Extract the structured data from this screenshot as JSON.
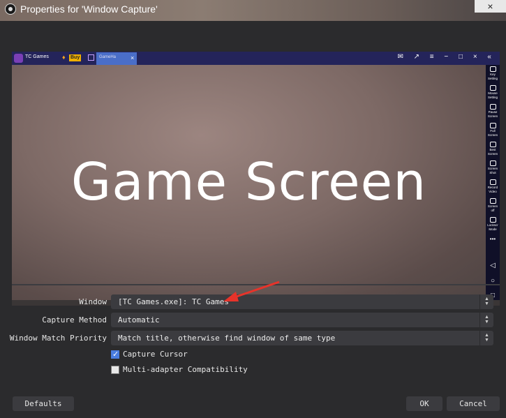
{
  "window": {
    "title": "Properties for 'Window Capture'",
    "close_glyph": "×"
  },
  "emulator": {
    "tab_app": "TC Games",
    "buy_label": "Buy",
    "active_tab": "GameHa",
    "tab_close": "×",
    "controls": "✉ ↗ ≡ − □ × «",
    "sidebar": [
      {
        "label": "Key Setting"
      },
      {
        "label": "Mouse Setting"
      },
      {
        "label": "Pause Screen"
      },
      {
        "label": "Full Screen"
      },
      {
        "label": "Best Screen"
      },
      {
        "label": "Screen Shot"
      },
      {
        "label": "Record Video"
      },
      {
        "label": "Screen off"
      },
      {
        "label": "Lockscr Mode"
      }
    ],
    "more": "•••",
    "nav_back": "◁",
    "nav_home": "○",
    "nav_recent": "□"
  },
  "preview": {
    "game_text": "Game Screen"
  },
  "form": {
    "window": {
      "label": "Window",
      "value": "[TC Games.exe]: TC Games"
    },
    "capture_method": {
      "label": "Capture Method",
      "value": "Automatic"
    },
    "match_priority": {
      "label": "Window Match Priority",
      "value": "Match title, otherwise find window of same type"
    },
    "capture_cursor": {
      "label": "Capture Cursor",
      "checked": true
    },
    "multi_adapter": {
      "label": "Multi-adapter Compatibility",
      "checked": false
    },
    "spin_glyph": "⌃⌄"
  },
  "buttons": {
    "defaults": "Defaults",
    "ok": "OK",
    "cancel": "Cancel"
  },
  "colors": {
    "accent": "#4a7de0",
    "arrow": "#e8332a",
    "dialog_bg": "#2b2b2d",
    "emu_bar": "#24245a"
  }
}
